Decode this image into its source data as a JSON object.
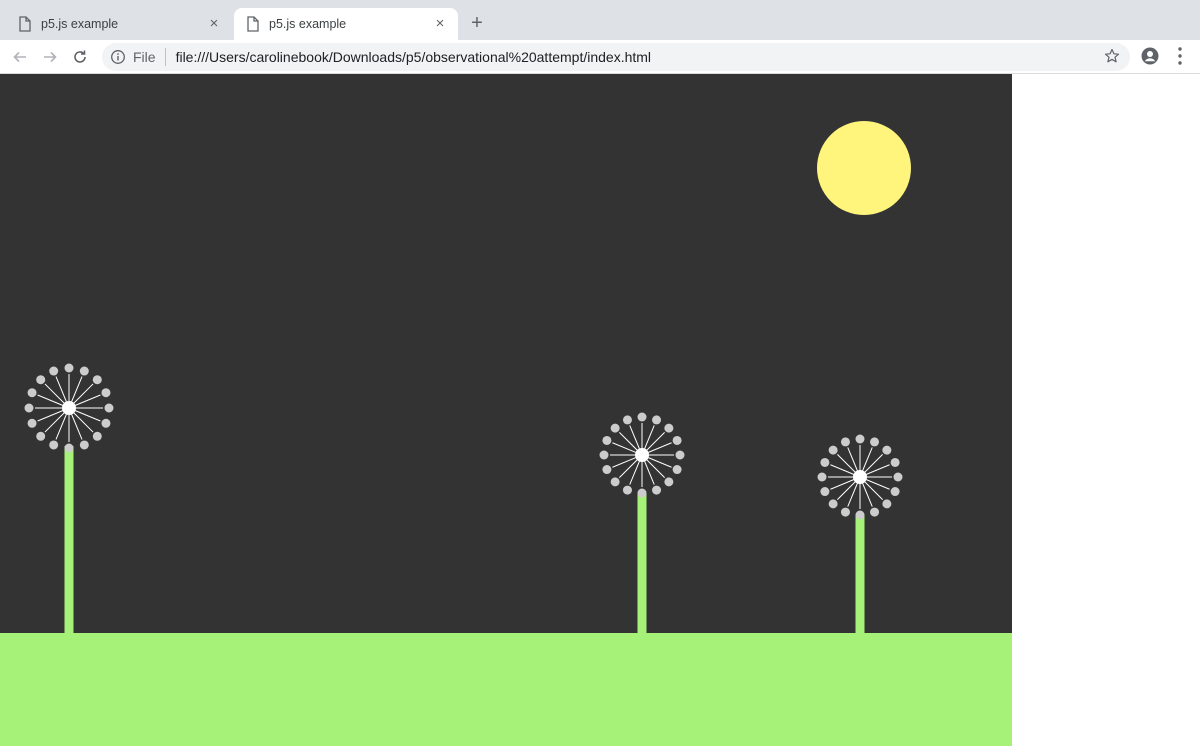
{
  "tabs": [
    {
      "title": "p5.js example",
      "close": "×",
      "active": false
    },
    {
      "title": "p5.js example",
      "close": "×",
      "active": true
    }
  ],
  "new_tab_label": "+",
  "toolbar": {
    "back_icon": "arrow-left-icon",
    "forward_icon": "arrow-right-icon",
    "reload_icon": "reload-icon",
    "scheme_label": "File",
    "url": "file:///Users/carolinebook/Downloads/p5/observational%20attempt/index.html",
    "bookmark_icon": "star-icon",
    "profile_icon": "account-icon",
    "menu_icon": "kebab-menu-icon"
  },
  "sketch": {
    "background_color": "#333333",
    "ground_color": "#a6f279",
    "sun_color": "#fff57c",
    "stem_color": "#a6f279",
    "seed_color": "#cccccc",
    "center_color": "#ffffff"
  }
}
